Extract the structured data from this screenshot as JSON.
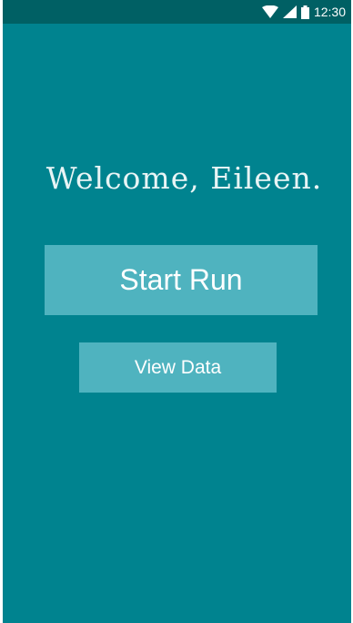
{
  "status_bar": {
    "time": "12:30",
    "icons": [
      "wifi-icon",
      "signal-icon",
      "battery-icon"
    ]
  },
  "main": {
    "welcome_text": "Welcome, Eileen.",
    "start_run_label": "Start Run",
    "view_data_label": "View Data"
  },
  "colors": {
    "background": "#00838f",
    "status_bar": "#006064",
    "button": "#4fb3bf",
    "text": "#ffffff"
  }
}
